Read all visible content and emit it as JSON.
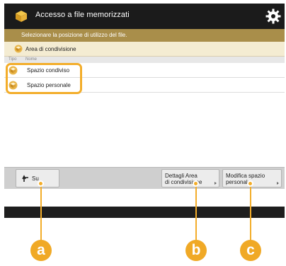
{
  "header": {
    "title": "Accesso a file memorizzati",
    "app_icon": "box-icon",
    "settings_icon": "gear-icon"
  },
  "instruction": "Selezionare la posizione di utilizzo del file.",
  "location": {
    "label": "Area di condivisione",
    "icon": "folder-box-icon"
  },
  "columns": [
    "Tipo",
    "Nome"
  ],
  "items": [
    {
      "label": "Spazio condiviso",
      "icon": "shared-space-icon"
    },
    {
      "label": "Spazio personale",
      "icon": "personal-space-icon"
    }
  ],
  "toolbar": {
    "up_label": "Su",
    "details_label_1": "Dettagli Area",
    "details_label_2": "di condivisione",
    "edit_label_1": "Modifica spazio",
    "edit_label_2": "personale"
  },
  "callouts": [
    "a",
    "b",
    "c"
  ],
  "colors": {
    "accent": "#f0a926",
    "header_bg": "#1b1b1b",
    "instruction_bg": "#a98e4a"
  }
}
